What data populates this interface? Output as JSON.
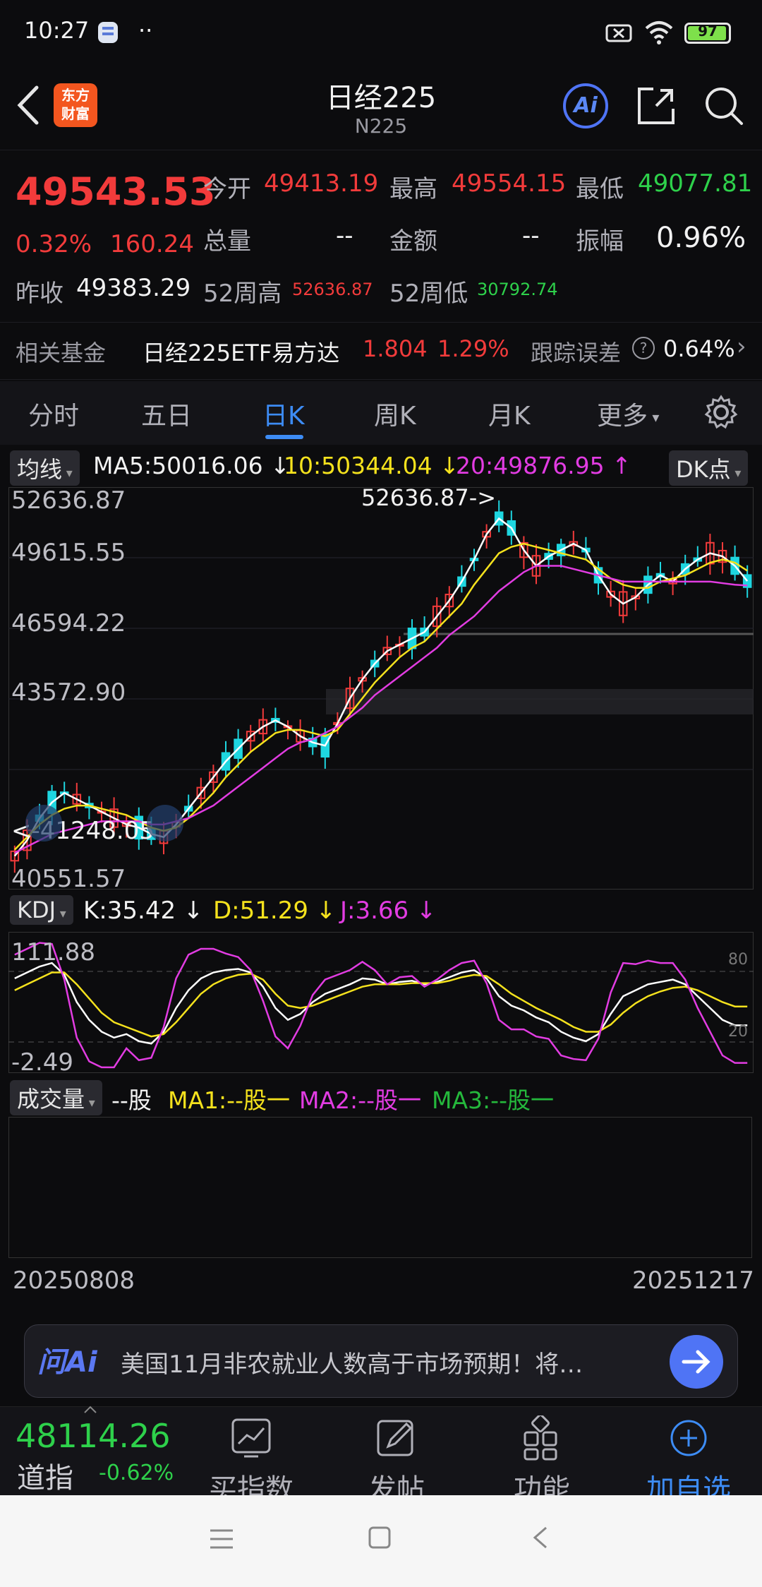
{
  "status_bar": {
    "time": "10:27",
    "battery": "97"
  },
  "header": {
    "title": "日经225",
    "subtitle": "N225",
    "logo_text": [
      "东方",
      "财富"
    ],
    "ai_label": "Ai"
  },
  "quote": {
    "price": "49543.53",
    "change_pct": "0.32%",
    "change_abs": "160.24",
    "prev_close_label": "昨收",
    "prev_close": "49383.29",
    "open_label": "今开",
    "open": "49413.19",
    "high_label": "最高",
    "high": "49554.15",
    "low_label": "最低",
    "low": "49077.81",
    "volume_label": "总量",
    "volume": "--",
    "amount_label": "金额",
    "amount": "--",
    "amplitude_label": "振幅",
    "amplitude": "0.96%",
    "w52_high_label": "52周高",
    "w52_high": "52636.87",
    "w52_low_label": "52周低",
    "w52_low": "30792.74"
  },
  "fund": {
    "label": "相关基金",
    "name": "日经225ETF易方达",
    "price": "1.804",
    "pct": "1.29%",
    "tracking_label": "跟踪误差",
    "tracking": "0.64%"
  },
  "tabs": [
    "分时",
    "五日",
    "日K",
    "周K",
    "月K",
    "更多"
  ],
  "active_tab": "日K",
  "ma_legend": {
    "selector": "均线",
    "ma5": "MA5:50016.06",
    "ma10": "10:50344.04",
    "ma20": "20:49876.95",
    "dk": "DK点"
  },
  "colors": {
    "up": "#f23b3b",
    "down": "#1ed6e0",
    "ma5": "#ffffff",
    "ma10": "#f5e21d",
    "ma20": "#e23ce2",
    "accent": "#3d8cf5"
  },
  "chart_data": [
    {
      "type": "candlestick",
      "title": "日K",
      "y_ticks": [
        "52636.87",
        "49615.55",
        "46594.22",
        "43572.90",
        "40551.57"
      ],
      "ylim": [
        40551.57,
        52636.87
      ],
      "max_annotation": "52636.87->",
      "min_annotation": "<-41248.05",
      "series": [
        {
          "name": "MA5",
          "values": [
            41300,
            41800,
            42500,
            43000,
            43300,
            43100,
            42900,
            42700,
            42500,
            42300,
            42200,
            42000,
            41900,
            42300,
            42800,
            43300,
            43800,
            44300,
            44700,
            45100,
            45400,
            45600,
            45400,
            45100,
            44900,
            44800,
            45500,
            46300,
            46900,
            47400,
            47800,
            48000,
            48200,
            48400,
            48900,
            49400,
            50000,
            50700,
            51500,
            52000,
            51700,
            51000,
            50500,
            50800,
            51000,
            51200,
            51000,
            50200,
            49600,
            49300,
            49500,
            49900,
            50200,
            50000,
            50400,
            50700,
            50900,
            50800,
            50500,
            50016
          ]
        },
        {
          "name": "10",
          "values": [
            41500,
            41900,
            42300,
            42600,
            42800,
            42900,
            42900,
            42800,
            42700,
            42600,
            42400,
            42200,
            42100,
            42200,
            42500,
            42900,
            43300,
            43800,
            44200,
            44600,
            44900,
            45200,
            45300,
            45300,
            45200,
            45100,
            45300,
            45800,
            46300,
            46800,
            47200,
            47600,
            47900,
            48100,
            48500,
            48900,
            49300,
            49900,
            50400,
            50900,
            51100,
            51200,
            51100,
            51000,
            50900,
            50800,
            50700,
            50400,
            50100,
            49900,
            49800,
            49800,
            50000,
            50100,
            50200,
            50400,
            50600,
            50700,
            50600,
            50344
          ]
        },
        {
          "name": "20",
          "values": [
            41400,
            41600,
            41800,
            42000,
            42100,
            42200,
            42300,
            42400,
            42400,
            42400,
            42400,
            42300,
            42300,
            42400,
            42500,
            42700,
            42900,
            43200,
            43500,
            43800,
            44100,
            44400,
            44700,
            44900,
            45000,
            45200,
            45400,
            45700,
            46000,
            46400,
            46700,
            47000,
            47300,
            47600,
            47900,
            48300,
            48600,
            48900,
            49300,
            49700,
            50000,
            50300,
            50500,
            50500,
            50500,
            50400,
            50300,
            50200,
            50100,
            50000,
            50000,
            50000,
            50000,
            50000,
            50000,
            50000,
            50000,
            49950,
            49900,
            49876
          ]
        }
      ]
    },
    {
      "type": "line",
      "title": "KDJ",
      "y_ticks": [
        "111.88",
        "-2.49"
      ],
      "ylim": [
        -2.49,
        111.88
      ],
      "ref_lines": [
        "80",
        "20"
      ],
      "series": [
        {
          "name": "K:35.42",
          "values": [
            75,
            80,
            85,
            88,
            78,
            55,
            40,
            30,
            25,
            28,
            22,
            20,
            30,
            50,
            65,
            75,
            80,
            82,
            83,
            80,
            68,
            50,
            40,
            45,
            55,
            62,
            66,
            70,
            75,
            74,
            70,
            72,
            73,
            70,
            72,
            76,
            80,
            82,
            75,
            60,
            52,
            48,
            42,
            38,
            30,
            25,
            22,
            28,
            45,
            60,
            65,
            70,
            72,
            74,
            70,
            60,
            50,
            40,
            35.42,
            35.42
          ]
        },
        {
          "name": "D:51.29",
          "values": [
            65,
            70,
            75,
            80,
            80,
            70,
            58,
            46,
            38,
            34,
            30,
            26,
            28,
            38,
            50,
            62,
            70,
            75,
            78,
            79,
            74,
            62,
            52,
            50,
            52,
            56,
            60,
            64,
            68,
            70,
            70,
            70,
            71,
            71,
            71,
            73,
            76,
            78,
            77,
            70,
            62,
            56,
            50,
            45,
            40,
            34,
            30,
            30,
            36,
            46,
            54,
            60,
            64,
            67,
            68,
            65,
            60,
            55,
            51.29,
            51.29
          ]
        },
        {
          "name": "J:3.66",
          "values": [
            95,
            100,
            105,
            104,
            74,
            25,
            5,
            0,
            0,
            16,
            6,
            8,
            34,
            75,
            95,
            100,
            100,
            96,
            93,
            82,
            56,
            26,
            16,
            35,
            61,
            74,
            78,
            82,
            89,
            82,
            70,
            76,
            77,
            68,
            74,
            82,
            88,
            90,
            71,
            40,
            32,
            32,
            26,
            24,
            10,
            7,
            6,
            24,
            63,
            88,
            87,
            90,
            88,
            88,
            74,
            50,
            30,
            10,
            3.66,
            3.66
          ]
        }
      ]
    }
  ],
  "kdj_legend": {
    "selector": "KDJ",
    "k": "K:35.42",
    "d": "D:51.29",
    "j": "J:3.66"
  },
  "vol_legend": {
    "selector": "成交量",
    "unit": "--股",
    "ma1": "MA1:--股一",
    "ma2": "MA2:--股一",
    "ma3": "MA3:--股一"
  },
  "dates": {
    "start": "20250808",
    "end": "20251217"
  },
  "ai_bar": {
    "logo": "问Ai",
    "message": "美国11月非农就业人数高于市场预期！将…"
  },
  "bottom_bar": {
    "index_price": "48114.26",
    "index_name": "道指",
    "index_pct": "-0.62%",
    "items": [
      "买指数",
      "发帖",
      "功能",
      "加自选"
    ]
  }
}
